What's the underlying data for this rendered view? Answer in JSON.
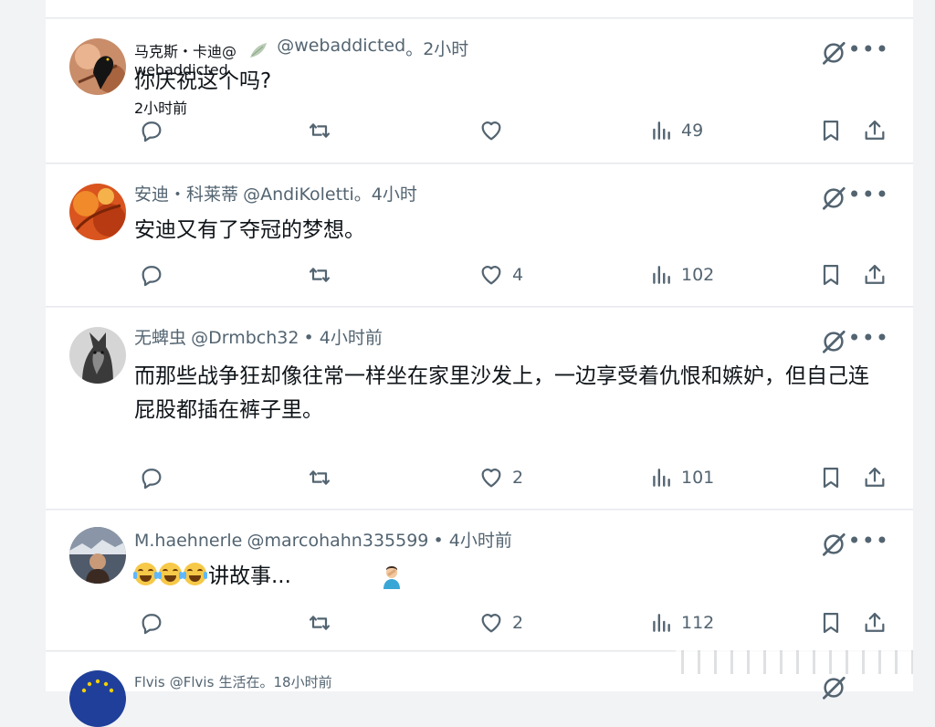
{
  "posts": [
    {
      "name": "马克斯・卡迪@",
      "handle_small": "webaddicted",
      "time_small": "2小时前",
      "handle": "@webaddicted",
      "time": "。2小时",
      "text": "你庆祝这个吗?",
      "likes": "",
      "views": "49",
      "avatar": "blackbird-icon"
    },
    {
      "name": "安迪・科莱蒂",
      "handle": "@AndiKoletti",
      "time": "。4小时",
      "text": "安迪又有了夺冠的梦想。",
      "likes": "4",
      "views": "102",
      "avatar": "autumn-leaves"
    },
    {
      "name": "无蜱虫",
      "handle": "@Drmbch32",
      "time": "• 4小时前",
      "text": "而那些战争狂却像往常一样坐在家里沙发上，一边享受着仇恨和嫉妒，但自己连屁股都插在裤子里。",
      "likes": "2",
      "views": "101",
      "avatar": "german-shepherd"
    },
    {
      "name": "M.haehnerle",
      "handle": "@marcohahn335599",
      "time": "• 4小时前",
      "text": "讲故事...",
      "likes": "2",
      "views": "112",
      "avatar": "person-photo"
    },
    {
      "name": "Flvis",
      "handle": "@Flvis",
      "time": "生活在。18小时前",
      "avatar": "eu-flag"
    }
  ],
  "icons": {
    "reply": "reply-icon",
    "repost": "repost-icon",
    "like": "heart-icon",
    "views": "views-icon",
    "bookmark": "bookmark-icon",
    "share": "share-icon",
    "grok": "grok-icon",
    "more": "more-icon"
  },
  "colors": {
    "text": "#0f1419",
    "muted": "#536471",
    "background": "#f2f3f5"
  }
}
